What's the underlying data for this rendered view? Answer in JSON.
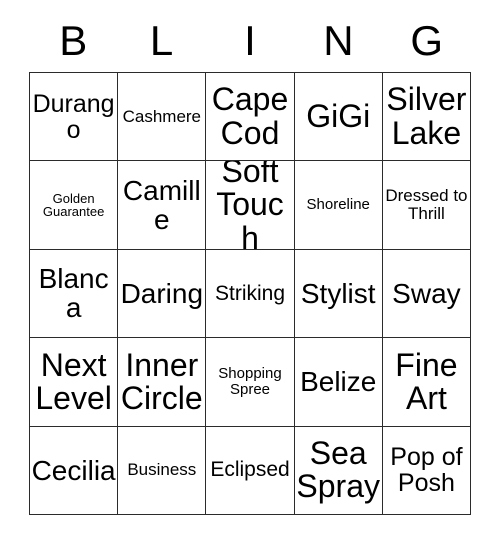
{
  "card": {
    "header_letters": [
      "B",
      "L",
      "I",
      "N",
      "G"
    ],
    "rows": [
      [
        {
          "text": "Durango",
          "size": "l"
        },
        {
          "text": "Cashmere",
          "size": "s"
        },
        {
          "text": "Cape Cod",
          "size": "xxl"
        },
        {
          "text": "GiGi",
          "size": "xxl"
        },
        {
          "text": "Silver Lake",
          "size": "xxl"
        }
      ],
      [
        {
          "text": "Golden Guarantee",
          "size": "xxs"
        },
        {
          "text": "Camille",
          "size": "xl"
        },
        {
          "text": "Soft Touch",
          "size": "xxl"
        },
        {
          "text": "Shoreline",
          "size": "xs"
        },
        {
          "text": "Dressed to Thrill",
          "size": "s"
        }
      ],
      [
        {
          "text": "Blanca",
          "size": "xl"
        },
        {
          "text": "Daring",
          "size": "xl"
        },
        {
          "text": "Striking",
          "size": "m"
        },
        {
          "text": "Stylist",
          "size": "xl"
        },
        {
          "text": "Sway",
          "size": "xl"
        }
      ],
      [
        {
          "text": "Next Level",
          "size": "xxl"
        },
        {
          "text": "Inner Circle",
          "size": "xxl"
        },
        {
          "text": "Shopping Spree",
          "size": "xs"
        },
        {
          "text": "Belize",
          "size": "xl"
        },
        {
          "text": "Fine Art",
          "size": "xxl"
        }
      ],
      [
        {
          "text": "Cecilia",
          "size": "xl"
        },
        {
          "text": "Business",
          "size": "s"
        },
        {
          "text": "Eclipsed",
          "size": "m"
        },
        {
          "text": "Sea Spray",
          "size": "xxl"
        },
        {
          "text": "Pop of Posh",
          "size": "l"
        }
      ]
    ]
  }
}
